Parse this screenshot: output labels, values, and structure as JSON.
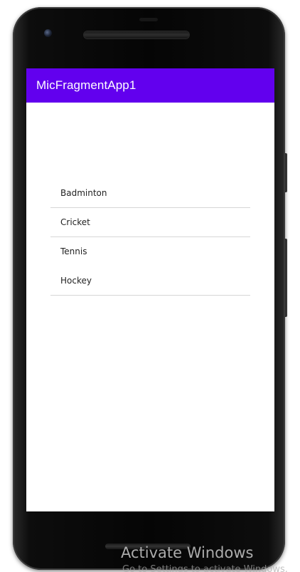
{
  "app": {
    "title": "MicFragmentApp1",
    "toolbar_color": "#6200ee"
  },
  "sports_list": {
    "items": [
      {
        "label": "Badminton"
      },
      {
        "label": "Cricket"
      },
      {
        "label": "Tennis"
      },
      {
        "label": "Hockey"
      }
    ]
  },
  "windows_watermark": {
    "title": "Activate Windows",
    "subtitle": "Go to Settings to activate Windows."
  }
}
